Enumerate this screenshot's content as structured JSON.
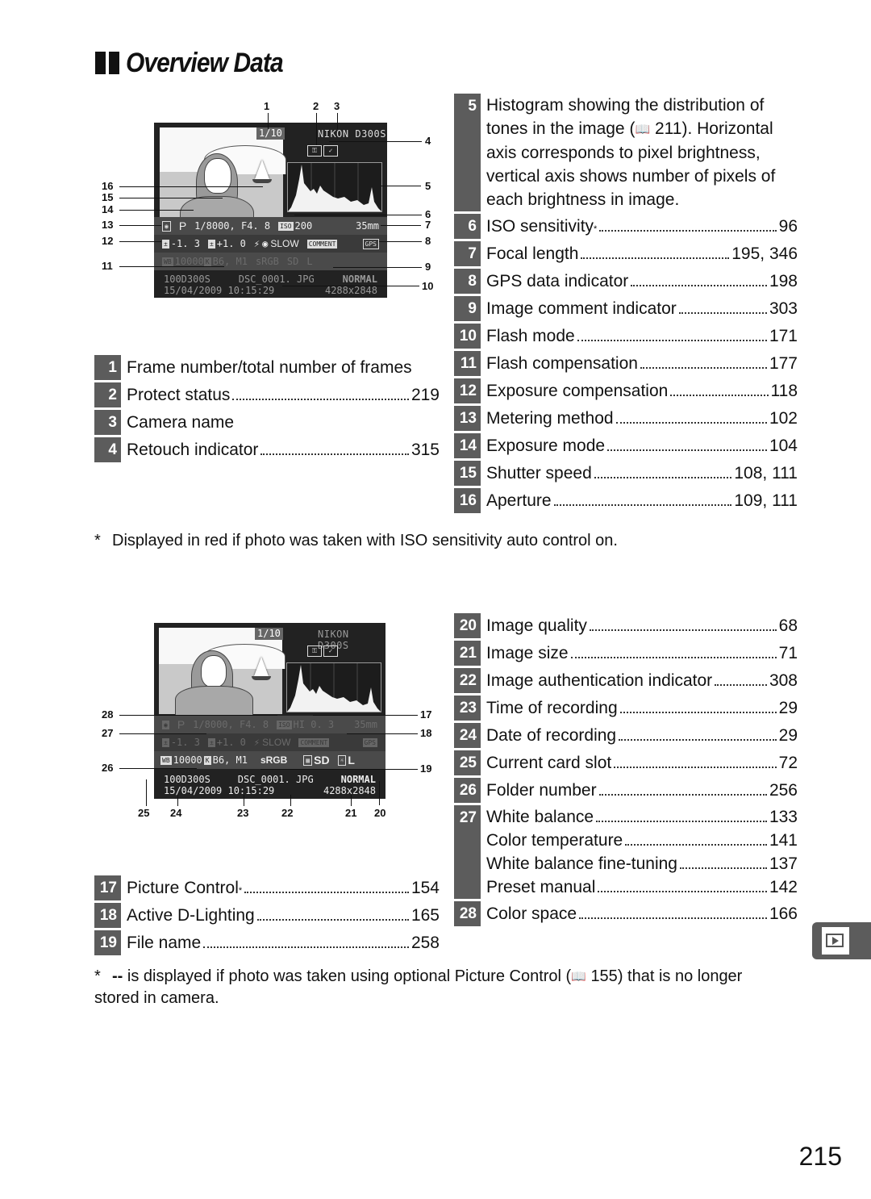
{
  "section": {
    "title": "Overview Data",
    "marker_icon": "double-bar-icon"
  },
  "screen1": {
    "frame": "1/10",
    "camera_name": "NIKON D300S",
    "protect_icon": "key-icon",
    "retouch_icon": "retouch-icon",
    "row1": {
      "metering_icon": "matrix-metering-icon",
      "mode": "P",
      "shutter_aperture": "1/8000,  F4. 8",
      "iso_label": "ISO",
      "iso": "200",
      "focal": "35mm"
    },
    "row2": {
      "exp_comp_icon": "exposure-compensation-icon",
      "exp_comp": "-1. 3",
      "flash_comp_icon": "flash-compensation-icon",
      "flash_comp": "+1. 0",
      "flash_mode": "SLOW",
      "comment": "COMMENT",
      "gps": "GPS"
    },
    "row3": {
      "wb": "WB",
      "wb_value": "10000",
      "k": "K",
      "fine": "B6, M1",
      "color_space": "sRGB",
      "picture_control": "SD",
      "adl": "L"
    },
    "info": {
      "folder": "100D300S",
      "file": "DSC_0001. JPG",
      "quality": "NORMAL",
      "date_time": "15/04/2009 10:15:29",
      "size": "4288x2848"
    }
  },
  "screen2": {
    "frame": "1/10",
    "camera_name": "NIKON D300S",
    "row1": {
      "mode": "P",
      "shutter_aperture": "1/8000,  F4. 8",
      "iso_label": "ISO",
      "iso": "HI 0. 3",
      "focal": "35mm"
    },
    "row2": {
      "exp_comp": "-1. 3",
      "flash_comp": "+1. 0",
      "flash_mode": "SLOW",
      "comment": "COMMENT",
      "gps": "GPS"
    },
    "row3": {
      "wb": "WB",
      "wb_value": "10000",
      "k": "K",
      "fine": "B6, M1",
      "color_space": "sRGB",
      "picture_control": "SD",
      "adl": "L"
    },
    "info": {
      "folder": "100D300S",
      "file": "DSC_0001. JPG",
      "quality": "NORMAL",
      "date_time": "15/04/2009 10:15:29",
      "size": "4288x2848"
    }
  },
  "callouts1": [
    "1",
    "2",
    "3",
    "4",
    "5",
    "6",
    "7",
    "8",
    "9",
    "10",
    "11",
    "12",
    "13",
    "14",
    "15",
    "16"
  ],
  "callouts2": [
    "17",
    "18",
    "19",
    "20",
    "21",
    "22",
    "23",
    "24",
    "25",
    "26",
    "27",
    "28"
  ],
  "list_a": [
    {
      "num": "1",
      "label": "Frame number/total number of frames",
      "page": ""
    },
    {
      "num": "2",
      "label": "Protect status",
      "page": "219"
    },
    {
      "num": "3",
      "label": "Camera name",
      "page": ""
    },
    {
      "num": "4",
      "label": "Retouch indicator",
      "page": "315"
    }
  ],
  "list_b": {
    "item5": {
      "num": "5",
      "text_before": "Histogram showing the distribution of tones in the image (",
      "ref": "211",
      "text_after": ").  Horizontal axis corresponds to pixel brightness, vertical axis shows number of pixels of each brightness in image."
    },
    "items": [
      {
        "num": "6",
        "label": "ISO sensitivity",
        "sup": "*",
        "page": "96"
      },
      {
        "num": "7",
        "label": "Focal length",
        "page": "195, 346"
      },
      {
        "num": "8",
        "label": "GPS data indicator",
        "page": "198"
      },
      {
        "num": "9",
        "label": "Image comment indicator",
        "page": "303"
      },
      {
        "num": "10",
        "label": "Flash mode",
        "page": "171"
      },
      {
        "num": "11",
        "label": "Flash compensation",
        "page": "177"
      },
      {
        "num": "12",
        "label": "Exposure compensation",
        "page": "118"
      },
      {
        "num": "13",
        "label": "Metering method",
        "page": "102"
      },
      {
        "num": "14",
        "label": "Exposure mode",
        "page": "104"
      },
      {
        "num": "15",
        "label": "Shutter speed",
        "page": "108, 111"
      },
      {
        "num": "16",
        "label": "Aperture",
        "page": "109, 111"
      }
    ]
  },
  "footnote1": {
    "star": "*",
    "text": "Displayed in red if photo was taken with ISO sensitivity auto control on."
  },
  "list_c": [
    {
      "num": "17",
      "label": "Picture Control",
      "sup": "*",
      "page": "154"
    },
    {
      "num": "18",
      "label": "Active D-Lighting",
      "page": "165"
    },
    {
      "num": "19",
      "label": "File name",
      "page": "258"
    }
  ],
  "list_d": {
    "items": [
      {
        "num": "20",
        "label": "Image quality",
        "page": "68"
      },
      {
        "num": "21",
        "label": "Image size",
        "page": "71"
      },
      {
        "num": "22",
        "label": "Image authentication indicator",
        "page": "308"
      },
      {
        "num": "23",
        "label": "Time of recording",
        "page": "29"
      },
      {
        "num": "24",
        "label": "Date of recording",
        "page": "29"
      },
      {
        "num": "25",
        "label": "Current card slot",
        "page": "72"
      },
      {
        "num": "26",
        "label": "Folder number",
        "page": "256"
      }
    ],
    "item27": {
      "num": "27",
      "entries": [
        {
          "label": "White balance",
          "page": "133"
        },
        {
          "label": "Color temperature",
          "page": "141"
        },
        {
          "label": "White balance fine-tuning",
          "page": "137"
        },
        {
          "label": "Preset manual",
          "page": "142"
        }
      ]
    },
    "item28": {
      "num": "28",
      "label": "Color space",
      "page": "166"
    }
  },
  "footnote2": {
    "star": "*",
    "dashes": "--",
    "text_before": " is displayed if photo was taken using optional Picture Control (",
    "ref": "155",
    "text_after": ") that is no longer stored in camera."
  },
  "page_number": "215",
  "side_tab": {
    "icon": "playback-icon"
  },
  "colors": {
    "badge": "#5c5c5c",
    "screen_bg": "#222222",
    "text": "#111111"
  }
}
